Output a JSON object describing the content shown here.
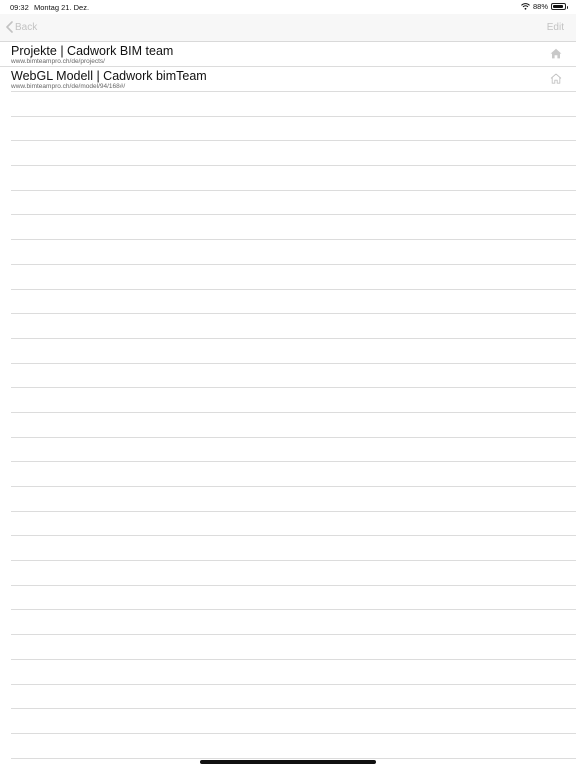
{
  "status": {
    "time": "09:32",
    "date": "Montag 21. Dez.",
    "battery": "88%"
  },
  "nav": {
    "back_label": "Back",
    "edit_label": "Edit"
  },
  "bookmarks": [
    {
      "title": "Projekte | Cadwork BIM team",
      "url": "www.bimteampro.ch/de/projects/",
      "icon": "home-icon-filled"
    },
    {
      "title": "WebGL Modell | Cadwork bimTeam",
      "url": "www.bimteampro.ch/de/model/94/168#/",
      "icon": "home-icon-outline"
    }
  ],
  "colors": {
    "disabled": "#c2c2c2",
    "separator": "#dcdcdc",
    "navbar": "#f7f7f7"
  }
}
